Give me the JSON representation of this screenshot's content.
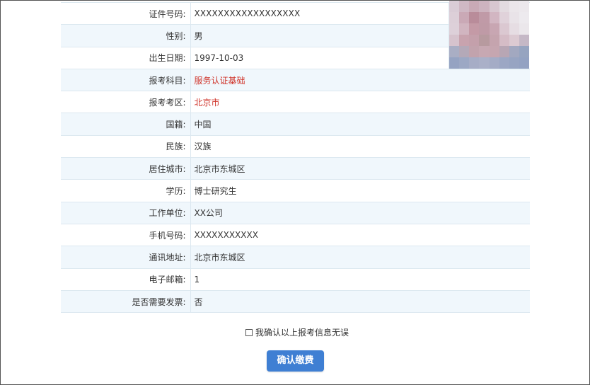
{
  "form": {
    "rows": [
      {
        "label": "证件号码:",
        "value": "XXXXXXXXXXXXXXXXXX",
        "style": "mono"
      },
      {
        "label": "性别:",
        "value": "男"
      },
      {
        "label": "出生日期:",
        "value": "1997-10-03"
      },
      {
        "label": "报考科目:",
        "value": "服务认证基础",
        "style": "red"
      },
      {
        "label": "报考考区:",
        "value": "北京市",
        "style": "red"
      },
      {
        "label": "国籍:",
        "value": "中国"
      },
      {
        "label": "民族:",
        "value": "汉族"
      },
      {
        "label": "居住城市:",
        "value": "北京市东城区"
      },
      {
        "label": "学历:",
        "value": "博士研究生"
      },
      {
        "label": "工作单位:",
        "value": "XX公司"
      },
      {
        "label": "手机号码:",
        "value": "XXXXXXXXXXX"
      },
      {
        "label": "通讯地址:",
        "value": "北京市东城区"
      },
      {
        "label": "电子邮箱:",
        "value": "1"
      },
      {
        "label": "是否需要发票:",
        "value": "否"
      }
    ]
  },
  "confirm_checkbox": {
    "label": "我确认以上报考信息无误",
    "checked": false
  },
  "pay_button": {
    "label": "确认缴费"
  },
  "colors": {
    "accent": "#3f7fd3",
    "highlight_text": "#d0352b",
    "row_alt_bg": "#f0f7fc"
  }
}
